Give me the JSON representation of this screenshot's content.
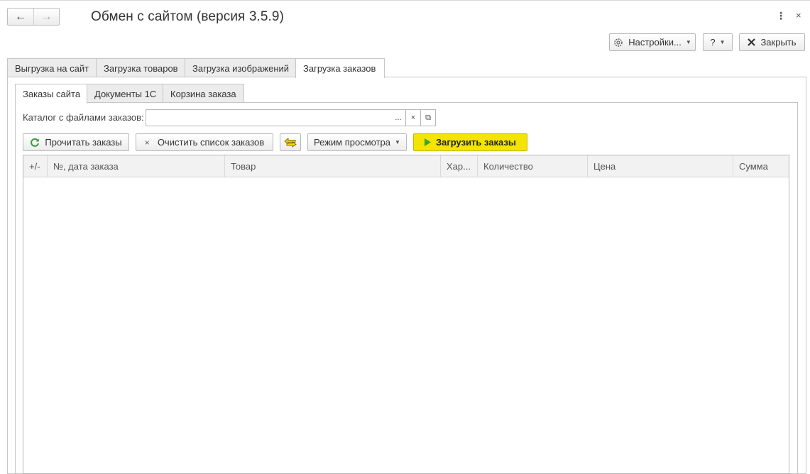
{
  "window": {
    "title": "Обмен с сайтом (версия 3.5.9)",
    "back_icon": "←",
    "forward_icon": "→",
    "more_icon": "⋮",
    "close_icon": "×"
  },
  "toolbar": {
    "settings_label": "Настройки...",
    "help_label": "?",
    "close_label": "Закрыть"
  },
  "tabs": [
    {
      "label": "Выгрузка на сайт"
    },
    {
      "label": "Загрузка товаров"
    },
    {
      "label": "Загрузка изображений"
    },
    {
      "label": "Загрузка заказов",
      "active": true
    }
  ],
  "subtabs": [
    {
      "label": "Заказы сайта",
      "active": true
    },
    {
      "label": "Документы 1С"
    },
    {
      "label": "Корзина заказа"
    }
  ],
  "catalog": {
    "label": "Каталог с файлами заказов:",
    "value": "",
    "select_btn": "...",
    "clear_btn": "×",
    "open_btn": "⧉"
  },
  "actions": {
    "read_label": "Прочитать заказы",
    "clear_label": "Очистить список заказов",
    "mode_label": "Режим просмотра",
    "load_label": "Загрузить заказы"
  },
  "table": {
    "columns": [
      "+/-",
      "№, дата заказа",
      "Товар",
      "Хар...",
      "Количество",
      "Цена",
      "Сумма"
    ],
    "rows": []
  },
  "colors": {
    "accent_yellow": "#f5e400",
    "play_green": "#3aa33a",
    "refresh_green": "#3c9a3c"
  }
}
